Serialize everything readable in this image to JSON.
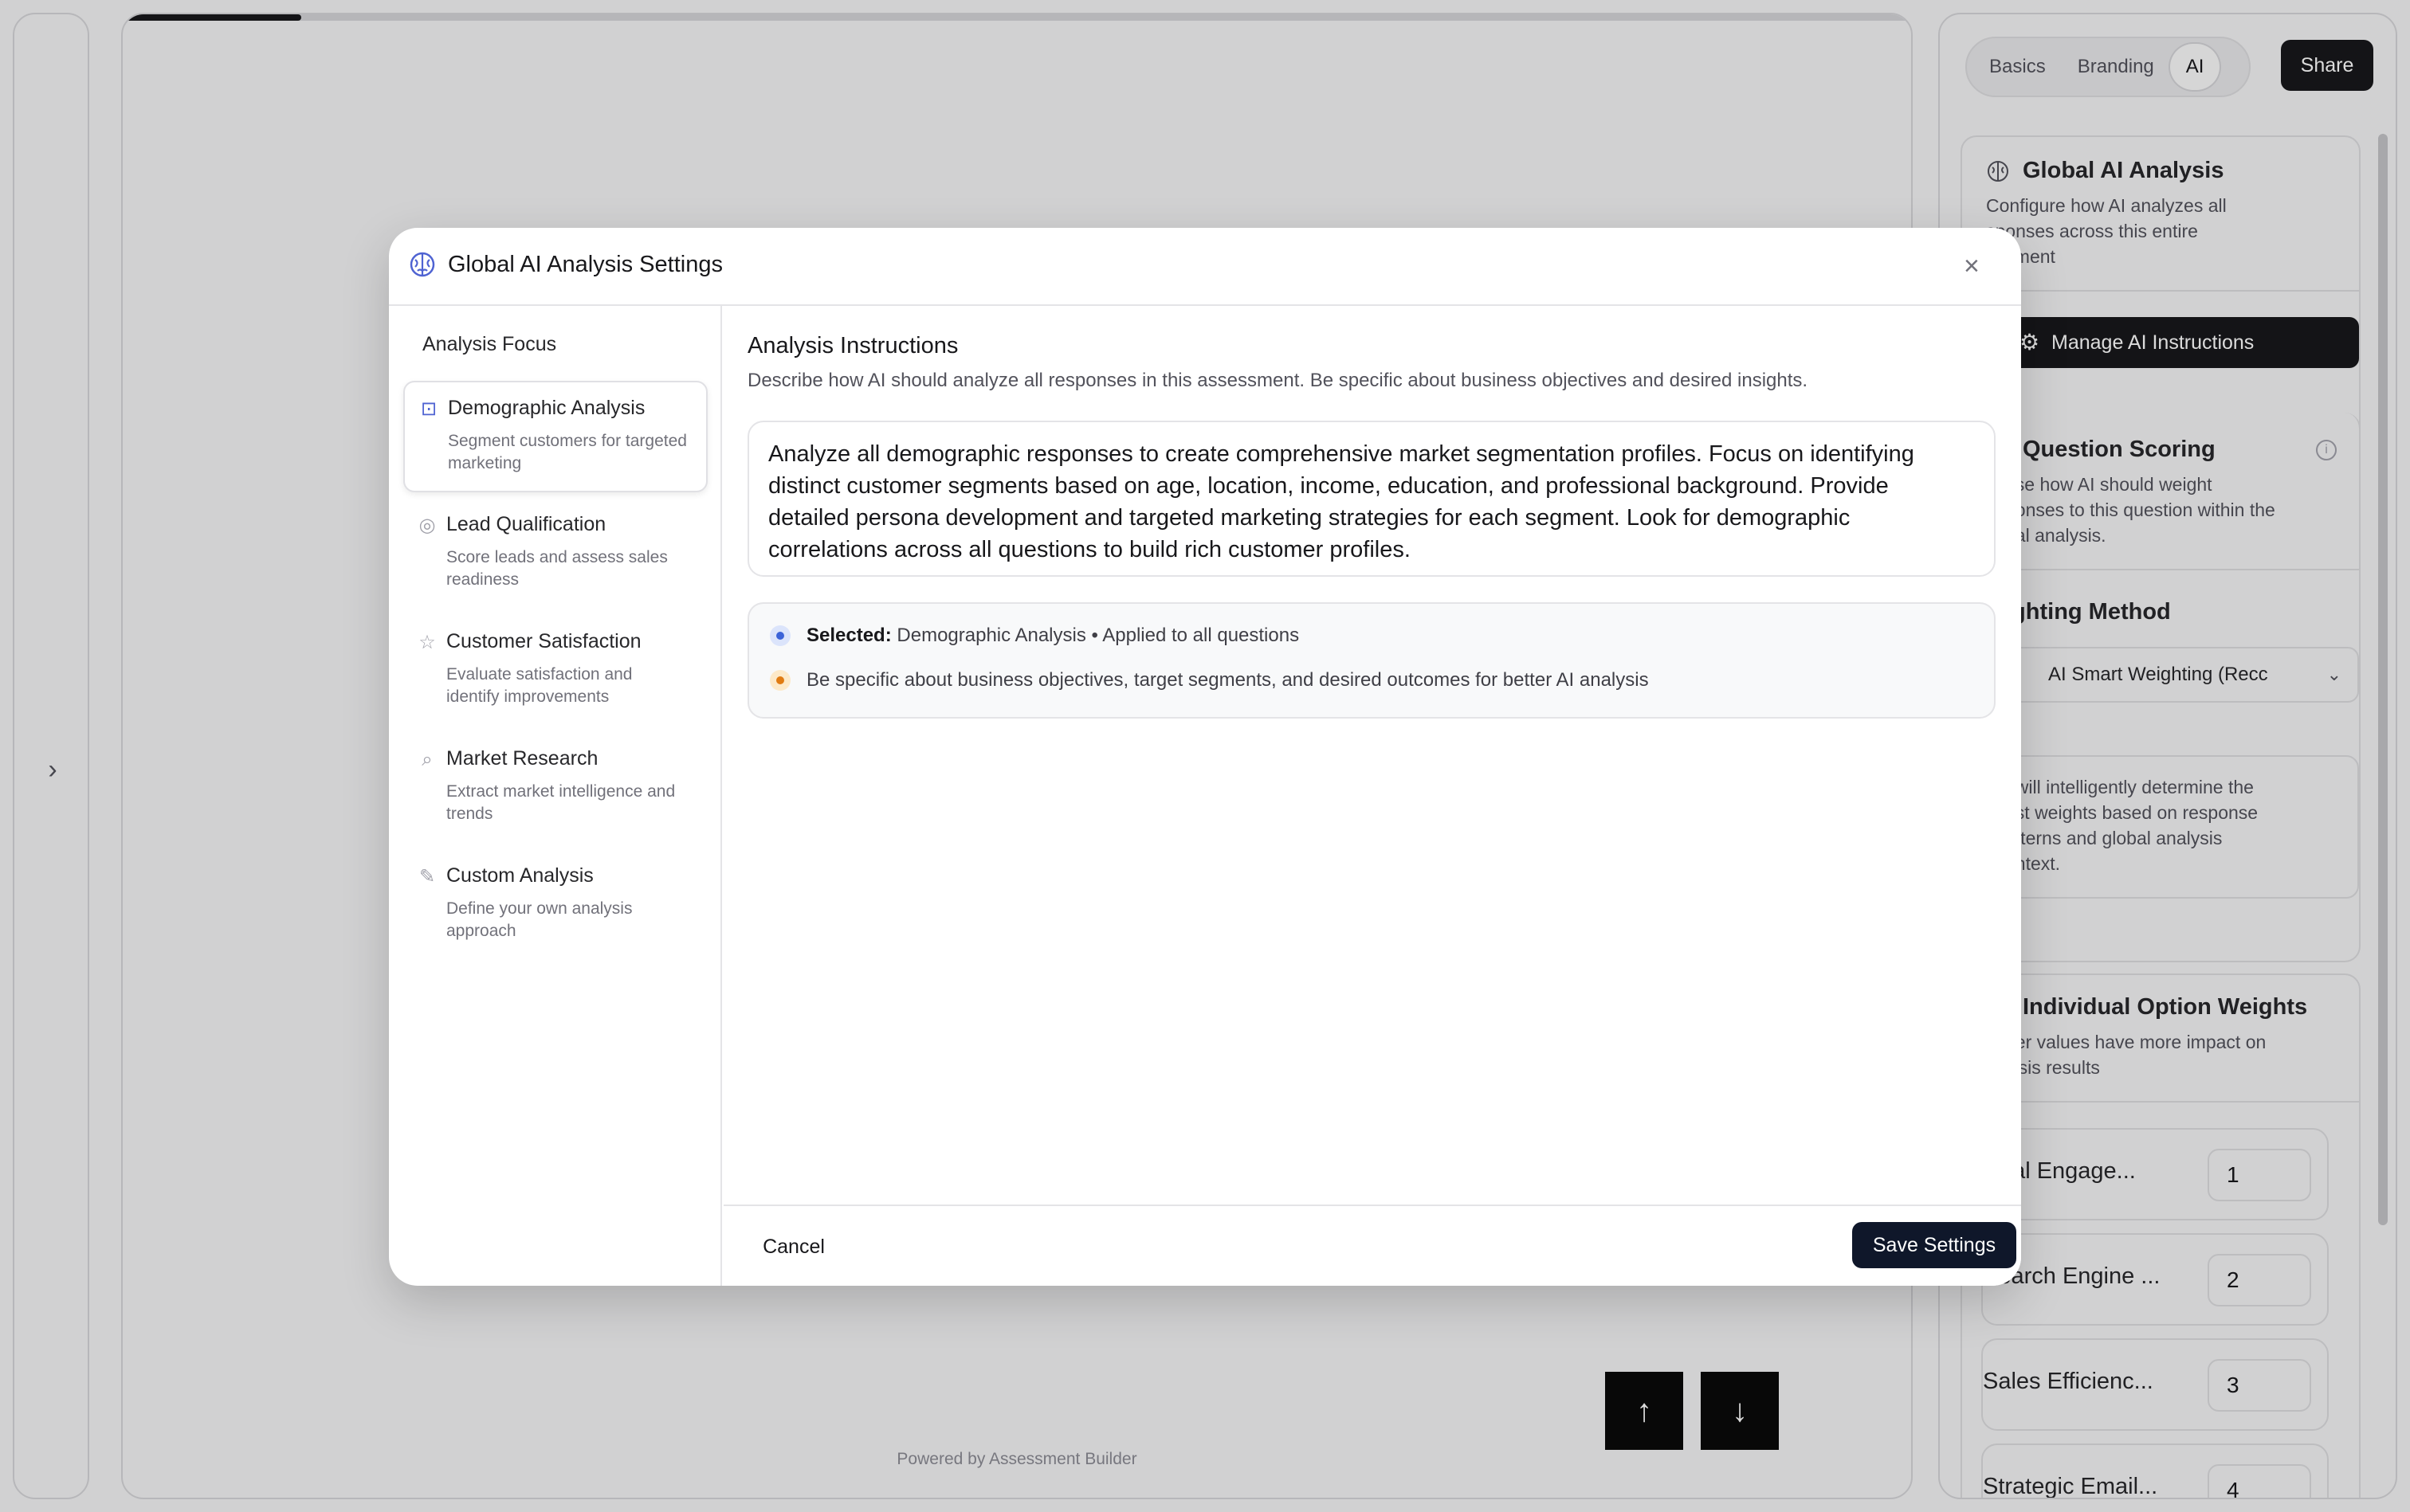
{
  "background": {
    "progress_fraction": 0.1,
    "powered_by": "Powered by Assessment Builder",
    "nav": {
      "up_icon": "↑",
      "down_icon": "↓"
    },
    "left_rail": {
      "expand_icon": "›"
    }
  },
  "right_panel": {
    "tabs": [
      {
        "label": "Basics",
        "active": false
      },
      {
        "label": "Branding",
        "active": false
      },
      {
        "label": "AI",
        "active": true
      }
    ],
    "share_label": "Share",
    "global_ai": {
      "title": "Global AI Analysis",
      "description": "Configure how AI analyzes all responses across this entire assessment",
      "visible_description": "Configure how AI analyzes all\nsponses across this entire\nessment",
      "manage_button": "Manage AI Instructions"
    },
    "question_scoring": {
      "title": "Question Scoring",
      "description": "ose how AI should weight\nponses to this question within the\nbal analysis.",
      "weighting_method_label": "ighting Method",
      "weighting_select": "AI Smart Weighting (Recc",
      "weighting_note": "I will intelligently determine the\nest weights based on response\natterns and global analysis\nontext."
    },
    "individual_weights": {
      "title": "Individual Option Weights",
      "description": "her values have more impact on\nlysis results",
      "rows": [
        {
          "label": "ocial Engage...",
          "value": "1"
        },
        {
          "label": "Search Engine ...",
          "value": "2"
        },
        {
          "label": "Sales Efficienc...",
          "value": "3"
        },
        {
          "label": "Strategic Email...",
          "value": "4"
        }
      ]
    }
  },
  "modal": {
    "title": "Global AI Analysis Settings",
    "close_icon": "×",
    "sidebar": {
      "heading": "Analysis Focus",
      "items": [
        {
          "title": "Demographic Analysis",
          "desc": "Segment customers for targeted marketing",
          "icon": "person-card-icon",
          "glyph": "⊡",
          "active": true
        },
        {
          "title": "Lead Qualification",
          "desc": "Score leads and assess sales readiness",
          "icon": "target-icon",
          "glyph": "◎",
          "active": false
        },
        {
          "title": "Customer Satisfaction",
          "desc": "Evaluate satisfaction and identify improvements",
          "icon": "star-icon",
          "glyph": "☆",
          "active": false
        },
        {
          "title": "Market Research",
          "desc": "Extract market intelligence and trends",
          "icon": "search-icon",
          "glyph": "⌕",
          "active": false
        },
        {
          "title": "Custom Analysis",
          "desc": "Define your own analysis approach",
          "icon": "pen-icon",
          "glyph": "✎",
          "active": false
        }
      ]
    },
    "main": {
      "title": "Analysis Instructions",
      "subtitle": "Describe how AI should analyze all responses in this assessment. Be specific about business objectives and desired insights.",
      "instructions": "Analyze all demographic responses to create comprehensive market segmentation profiles. Focus on identifying distinct customer segments based on age, location, income, education, and professional background. Provide detailed persona development and targeted marketing strategies for each segment. Look for demographic correlations across all questions to build rich customer profiles.",
      "selected_label": "Selected:",
      "selected_value": "Demographic Analysis • Applied to all questions",
      "tip": "Be specific about business objectives, target segments, and desired outcomes for better AI analysis"
    },
    "footer": {
      "cancel": "Cancel",
      "save": "Save Settings"
    }
  },
  "colors": {
    "accent": "#4f63d2",
    "primary_button": "#0f172a",
    "info_dot": "#3b63d8",
    "warning_dot": "#e07b12"
  }
}
